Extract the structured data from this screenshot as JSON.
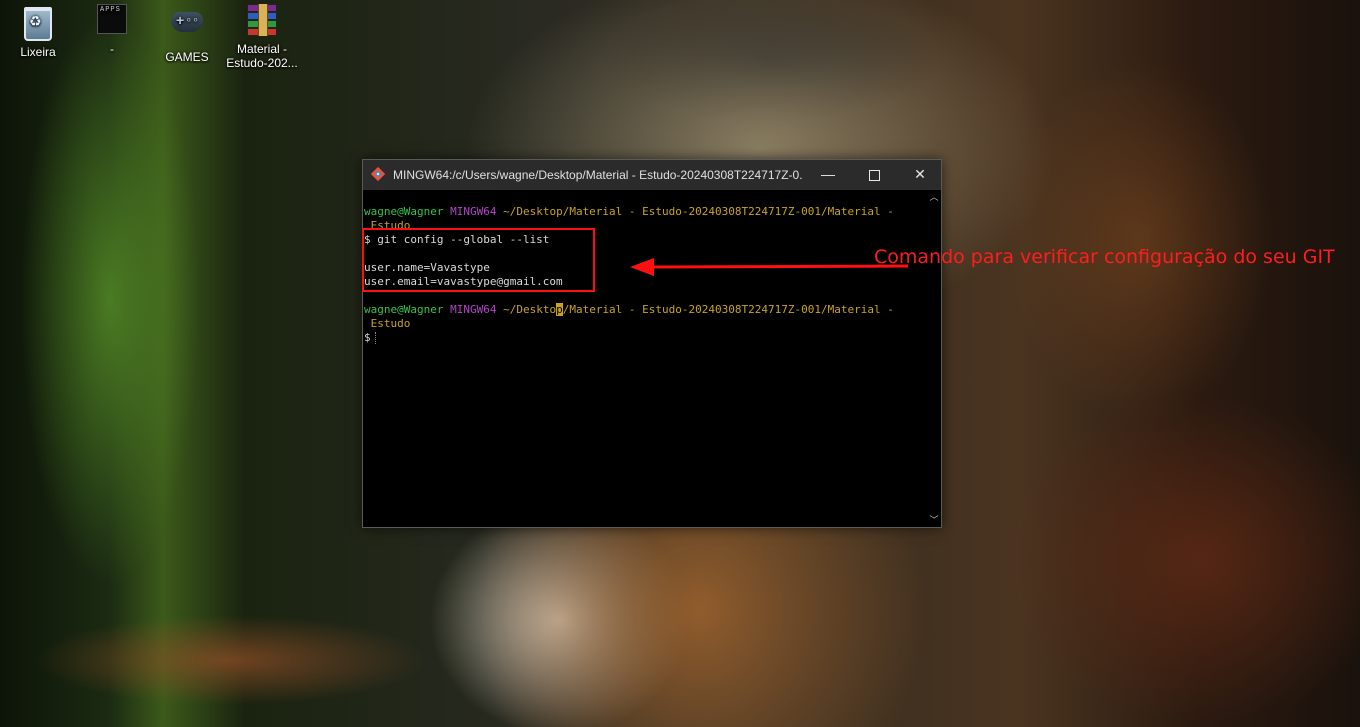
{
  "desktop": {
    "icons": [
      {
        "label": "Lixeira",
        "icon": "recycle-bin-icon"
      },
      {
        "label": "-",
        "icon": "apps-folder-icon",
        "icon_text": "APPS"
      },
      {
        "label": "GAMES",
        "icon": "gamepad-icon"
      },
      {
        "label_line1": "Material -",
        "label_line2": "Estudo-202...",
        "icon": "winrar-archive-icon"
      }
    ]
  },
  "terminal": {
    "title": "MINGW64:/c/Users/wagne/Desktop/Material - Estudo-20240308T224717Z-0...",
    "buttons": {
      "minimize": "—",
      "close": "✕"
    },
    "prompt1": {
      "user": "wagne@Wagner",
      "host": "MINGW64",
      "path": "~/Desktop/Material - Estudo-20240308T224717Z-001/Material -",
      "path_cont": " Estudo"
    },
    "command": "$ git config --global --list",
    "output": [
      "user.name=Vavastype",
      "user.email=vavastype@gmail.com"
    ],
    "prompt2": {
      "user": "wagne@Wagner",
      "host": "MINGW64",
      "path_a": "~/Deskto",
      "path_cursor": "p",
      "path_b": "/Material - Estudo-20240308T224717Z-001/Material -",
      "path_cont": " Estudo"
    },
    "dollar": "$"
  },
  "annotation": {
    "text": "Comando para verificar configuração do seu GIT",
    "color": "#ff1d1d"
  }
}
